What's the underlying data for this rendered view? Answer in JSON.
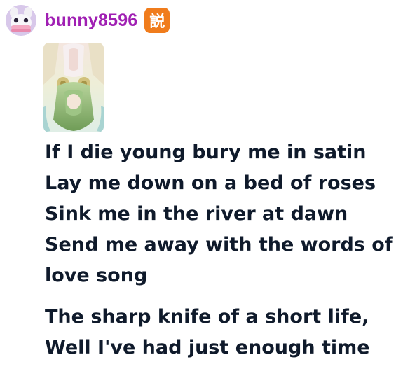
{
  "post": {
    "author": {
      "username": "bunny8596",
      "badge": "説",
      "avatar_icon": "bunny-avatar-icon"
    },
    "image": {
      "icon": "anime-figure-thumbnail",
      "colors": [
        "#e8e3c8",
        "#7fae67",
        "#f2e4dd"
      ]
    },
    "lyrics": {
      "stanza1": {
        "line1": "If I die young bury me in satin",
        "line2": "Lay me down on a bed of roses",
        "line3": "Sink me in the river at dawn",
        "line4": "Send me away with the words of a",
        "line5": "love song"
      },
      "stanza2": {
        "line1": "The sharp knife of a short life,",
        "line2": "Well I've had just enough time"
      }
    }
  },
  "colors": {
    "username": "#a01fb3",
    "badge": "#f07c1c",
    "text": "#0f1a2b"
  }
}
